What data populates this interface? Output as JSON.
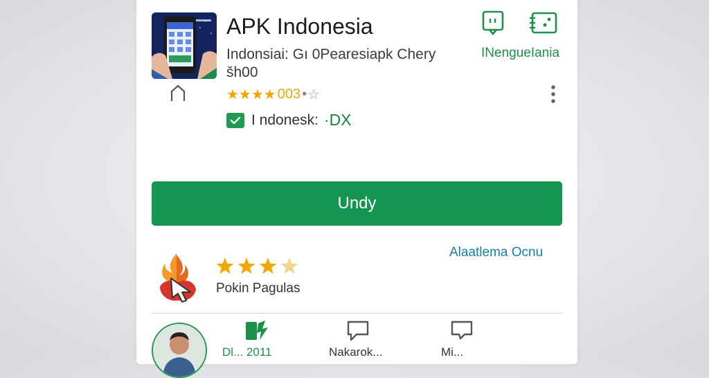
{
  "app": {
    "title": "APK Indonesia",
    "subtitle": "Indonsiai: Gı 0Pearesiapk Chery",
    "subtitle2": "šh00",
    "rating_stars": "★★★★",
    "rating_count": "003",
    "rating_dot": "•",
    "rating_star_empty": "☆",
    "badge_text": "I ndonesk:",
    "badge_code": "·DX"
  },
  "header": {
    "top_link": "INengueIania"
  },
  "install_button": {
    "label": "Undy"
  },
  "review": {
    "link": "Alaatlema Ocnu",
    "label": "Pokin Pagulas",
    "stars_filled": 3,
    "stars_total": 4
  },
  "tabs": [
    {
      "label": "Dl...  2011",
      "icon": "phone-arrow-icon",
      "active": true
    },
    {
      "label": "Nakarok...",
      "icon": "chat-icon",
      "active": false
    },
    {
      "label": "Mi...",
      "icon": "chat-icon",
      "active": false
    }
  ],
  "colors": {
    "accent": "#159552",
    "star": "#f2a600",
    "link": "#127fa8"
  }
}
